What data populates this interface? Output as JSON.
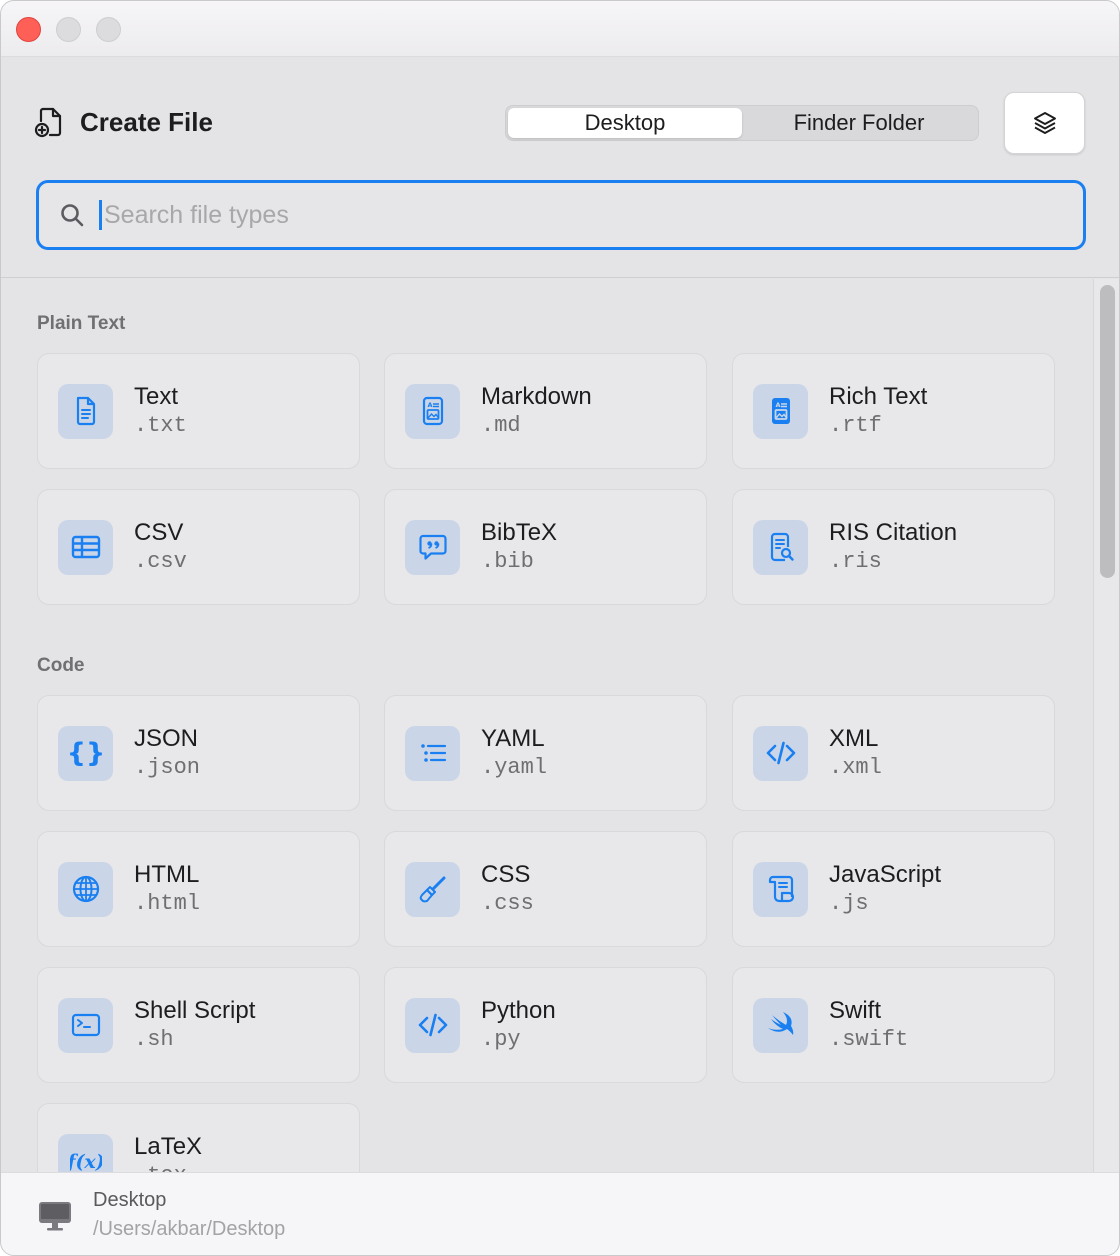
{
  "header": {
    "title": "Create File",
    "segments": [
      "Desktop",
      "Finder Folder"
    ],
    "active_segment": "Desktop"
  },
  "search": {
    "placeholder": "Search file types",
    "value": ""
  },
  "sections": [
    {
      "label": "Plain Text",
      "items": [
        {
          "name": "Text",
          "ext": ".txt",
          "icon": "doc-text-icon"
        },
        {
          "name": "Markdown",
          "ext": ".md",
          "icon": "doc-richtext-icon"
        },
        {
          "name": "Rich Text",
          "ext": ".rtf",
          "icon": "doc-richtext-filled-icon"
        },
        {
          "name": "CSV",
          "ext": ".csv",
          "icon": "table-icon"
        },
        {
          "name": "BibTeX",
          "ext": ".bib",
          "icon": "quote-bubble-icon"
        },
        {
          "name": "RIS Citation",
          "ext": ".ris",
          "icon": "doc-magnifier-icon"
        }
      ]
    },
    {
      "label": "Code",
      "items": [
        {
          "name": "JSON",
          "ext": ".json",
          "icon": "curly-braces-icon"
        },
        {
          "name": "YAML",
          "ext": ".yaml",
          "icon": "list-bullet-icon"
        },
        {
          "name": "XML",
          "ext": ".xml",
          "icon": "code-brackets-icon"
        },
        {
          "name": "HTML",
          "ext": ".html",
          "icon": "globe-icon"
        },
        {
          "name": "CSS",
          "ext": ".css",
          "icon": "paintbrush-icon"
        },
        {
          "name": "JavaScript",
          "ext": ".js",
          "icon": "scroll-icon"
        },
        {
          "name": "Shell Script",
          "ext": ".sh",
          "icon": "terminal-icon"
        },
        {
          "name": "Python",
          "ext": ".py",
          "icon": "code-brackets-icon"
        },
        {
          "name": "Swift",
          "ext": ".swift",
          "icon": "swift-icon"
        },
        {
          "name": "LaTeX",
          "ext": ".tex",
          "icon": "function-icon"
        }
      ]
    }
  ],
  "footer": {
    "title": "Desktop",
    "path": "/Users/akbar/Desktop"
  },
  "colors": {
    "accent": "#1a7ff0",
    "icon_tile": "#cad6e8",
    "close": "#fe5f57"
  }
}
